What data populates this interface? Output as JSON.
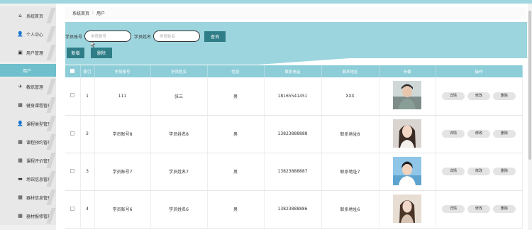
{
  "sidebar": {
    "items": [
      {
        "label": "系统首页",
        "icon": "home-icon",
        "glyph": "⌂"
      },
      {
        "label": "个人中心",
        "icon": "person-icon",
        "glyph": "👤"
      },
      {
        "label": "用户管理",
        "icon": "user-manage-icon",
        "glyph": "▣"
      },
      {
        "label": "教练管理",
        "icon": "send-icon",
        "glyph": "✈"
      },
      {
        "label": "健身课程管理",
        "icon": "grid-icon",
        "glyph": "▦"
      },
      {
        "label": "课程类型管理",
        "icon": "person-icon",
        "glyph": "👤"
      },
      {
        "label": "课程预约管理",
        "icon": "grid-icon",
        "glyph": "▦"
      },
      {
        "label": "课程评价管理",
        "icon": "grid-icon",
        "glyph": "▦"
      },
      {
        "label": "场馆信息管理",
        "icon": "chat-icon",
        "glyph": "▬"
      },
      {
        "label": "器材信息管理",
        "icon": "grid-icon",
        "glyph": "▦"
      },
      {
        "label": "器材报修管理",
        "icon": "grid-icon",
        "glyph": "▦"
      }
    ],
    "subitem": "用户"
  },
  "breadcrumb": {
    "home": "系统首页",
    "sep": "⁝",
    "current": "用户"
  },
  "search": {
    "account_label": "学员账号",
    "account_placeholder": "学员账号",
    "name_label": "学员姓名",
    "name_placeholder": "学员姓名",
    "button": "查询"
  },
  "actions": {
    "add": "新增",
    "delete": "删除"
  },
  "table": {
    "headers": [
      "索引",
      "学员账号",
      "学员姓名",
      "性别",
      "联系电话",
      "联系地址",
      "头像",
      "操作"
    ],
    "rows": [
      {
        "index": "1",
        "account": "111",
        "name": "张三",
        "gender": "男",
        "phone": "18165541451",
        "address": "XXX"
      },
      {
        "index": "2",
        "account": "学员账号8",
        "name": "学员姓名8",
        "gender": "男",
        "phone": "13823888888",
        "address": "联系地址8"
      },
      {
        "index": "3",
        "account": "学员账号7",
        "name": "学员姓名7",
        "gender": "男",
        "phone": "13823888887",
        "address": "联系地址7"
      },
      {
        "index": "4",
        "account": "学员账号6",
        "name": "学员姓名6",
        "gender": "男",
        "phone": "13823888886",
        "address": "联系地址6"
      }
    ],
    "row_actions": {
      "detail": "详情",
      "edit": "修改",
      "delete": "删除"
    }
  },
  "colors": {
    "accent": "#8dcdd8",
    "panel": "#9dd5de",
    "button": "#2e7d87",
    "sidebar_active": "#6fbfcc"
  }
}
